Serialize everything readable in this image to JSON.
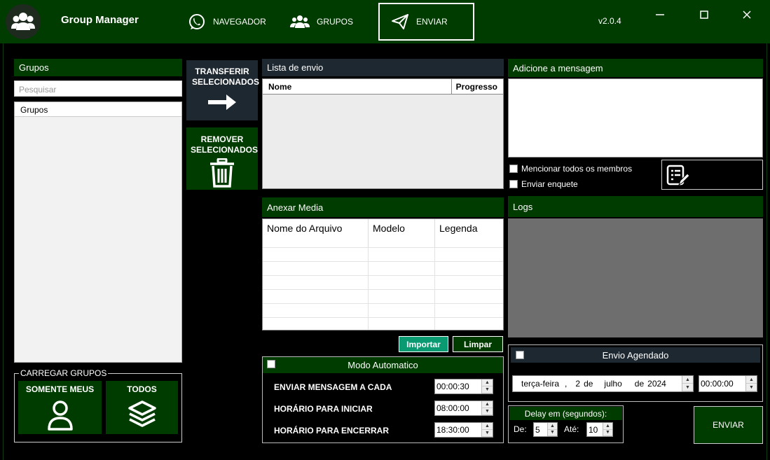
{
  "app": {
    "title": "Group Manager",
    "version": "v2.0.4"
  },
  "nav": {
    "navegador": "NAVEGADOR",
    "grupos": "GRUPOS",
    "enviar": "ENVIAR"
  },
  "grupos": {
    "header": "Grupos",
    "search_placeholder": "Pesquisar",
    "list_header": "Grupos",
    "load_legend": "CARREGAR GRUPOS",
    "somente_meus": "SOMENTE MEUS",
    "todos": "TODOS"
  },
  "actions": {
    "transferir": "TRANSFERIR SELECIONADOS",
    "remover": "REMOVER SELECIONADOS"
  },
  "lista": {
    "header": "Lista de envio",
    "col_nome": "Nome",
    "col_progresso": "Progresso"
  },
  "media": {
    "header": "Anexar Media",
    "col_arquivo": "Nome do Arquivo",
    "col_modelo": "Modelo",
    "col_legenda": "Legenda",
    "importar": "Importar",
    "limpar": "Limpar"
  },
  "modo": {
    "header": "Modo Automatico",
    "enviar_label": "ENVIAR MENSAGEM A CADA",
    "enviar_value": "00:00:30",
    "iniciar_label": "HORÁRIO PARA INICIAR",
    "iniciar_value": "08:00:00",
    "encerrar_label": "HORÁRIO PARA ENCERRAR",
    "encerrar_value": "18:30:00"
  },
  "mensagem": {
    "header": "Adicione a mensagem",
    "mencionar": "Mencionar todos os membros",
    "enquete": "Enviar enquete"
  },
  "logs": {
    "header": "Logs"
  },
  "agendado": {
    "header": "Envio Agendado",
    "weekday": "terça-feira",
    "sep": ",",
    "day": "2",
    "de1": "de",
    "month": "julho",
    "de2": "de",
    "year": "2024",
    "time": "00:00:00"
  },
  "delay": {
    "header": "Delay em (segundos):",
    "de_label": "De:",
    "de_value": "5",
    "ate_label": "Até:",
    "ate_value": "10"
  },
  "enviar_button": "ENVIAR"
}
